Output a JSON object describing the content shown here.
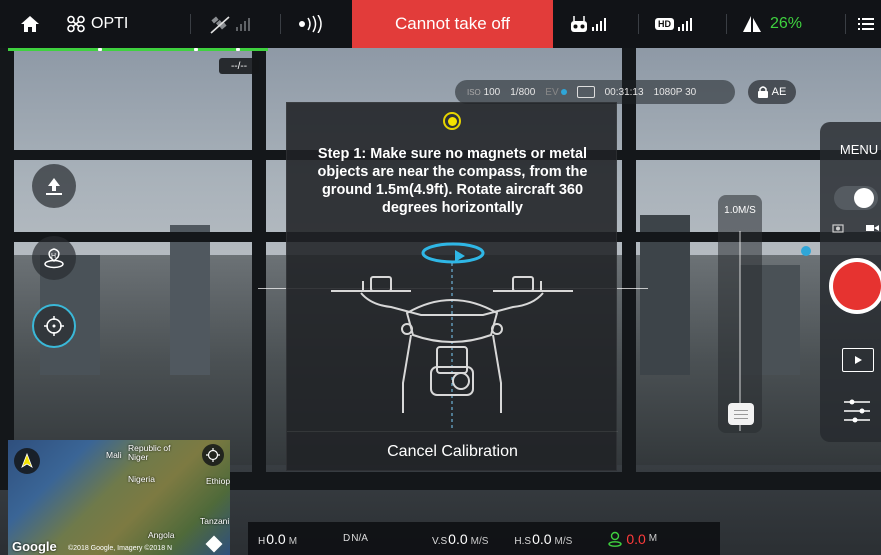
{
  "topbar": {
    "home_icon": "home-icon",
    "aircraft_name": "OPTI",
    "status_alert": "Cannot take off",
    "battery_percent": "26%",
    "battery_color": "#3fd13f",
    "alert_color": "#e23c3a",
    "hd_label": "HD"
  },
  "progress": {
    "marker_label": "--/--"
  },
  "camera": {
    "iso_label": "ISO",
    "iso": "100",
    "shutter": "1/800",
    "ev_label": "EV",
    "remaining": "00:31:13",
    "resolution": "1080P 30",
    "ae_label": "AE"
  },
  "calibration": {
    "instruction": "Step 1: Make sure no magnets or metal objects are near the compass, from the ground 1.5m(4.9ft). Rotate aircraft 360 degrees horizontally",
    "cancel_label": "Cancel Calibration"
  },
  "speed_slider": {
    "value": "1.0M/S"
  },
  "right_panel": {
    "menu_label": "MENU"
  },
  "map": {
    "labels": [
      "Mali",
      "Republic of Niger",
      "Nigeria",
      "Ethiop",
      "Tanzani",
      "Angola"
    ],
    "google_label": "Google",
    "attribution": "©2018 Google, Imagery ©2018 N"
  },
  "telemetry": {
    "h_label": "H",
    "h_value": "0.0",
    "h_unit": "M",
    "d_label": "D",
    "d_value": "N/A",
    "vs_label": "V.S",
    "vs_value": "0.0",
    "vs_unit": "M/S",
    "hs_label": "H.S",
    "hs_value": "0.0",
    "hs_unit": "M/S",
    "home_dist_value": "0.0",
    "home_dist_unit": "M",
    "home_dist_color": "#ff3b3b"
  }
}
